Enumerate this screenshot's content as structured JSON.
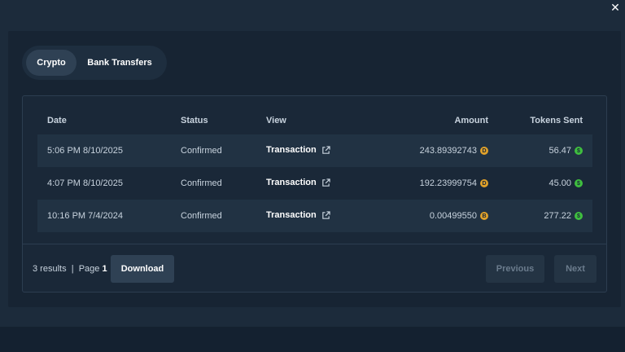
{
  "close_glyph": "✕",
  "tabs": [
    {
      "label": "Crypto",
      "active": true
    },
    {
      "label": "Bank Transfers",
      "active": false
    }
  ],
  "table": {
    "headers": {
      "date": "Date",
      "status": "Status",
      "view": "View",
      "amount": "Amount",
      "tokens": "Tokens Sent"
    },
    "rows": [
      {
        "date": "5:06 PM 8/10/2025",
        "status": "Confirmed",
        "view": "Transaction",
        "amount": "243.89392743",
        "amount_coin": "D",
        "tokens": "56.47",
        "tokens_coin": "$"
      },
      {
        "date": "4:07 PM 8/10/2025",
        "status": "Confirmed",
        "view": "Transaction",
        "amount": "192.23999754",
        "amount_coin": "D",
        "tokens": "45.00",
        "tokens_coin": "$"
      },
      {
        "date": "10:16 PM 7/4/2024",
        "status": "Confirmed",
        "view": "Transaction",
        "amount": "0.00499550",
        "amount_coin": "B",
        "tokens": "277.22",
        "tokens_coin": "$"
      }
    ]
  },
  "footer": {
    "results_text": "3 results",
    "separator": "|",
    "page_label": "Page",
    "page_number": "1",
    "download_label": "Download",
    "previous_label": "Previous",
    "next_label": "Next"
  },
  "colors": {
    "amount_coin": "#e0a12a",
    "tokens_coin": "#3fbf3f",
    "accent_button": "#2f4154"
  },
  "icons": {
    "close": "close-icon",
    "external_link": "external-link-icon",
    "amount_coin": "coin-icon",
    "tokens_coin": "token-icon"
  }
}
